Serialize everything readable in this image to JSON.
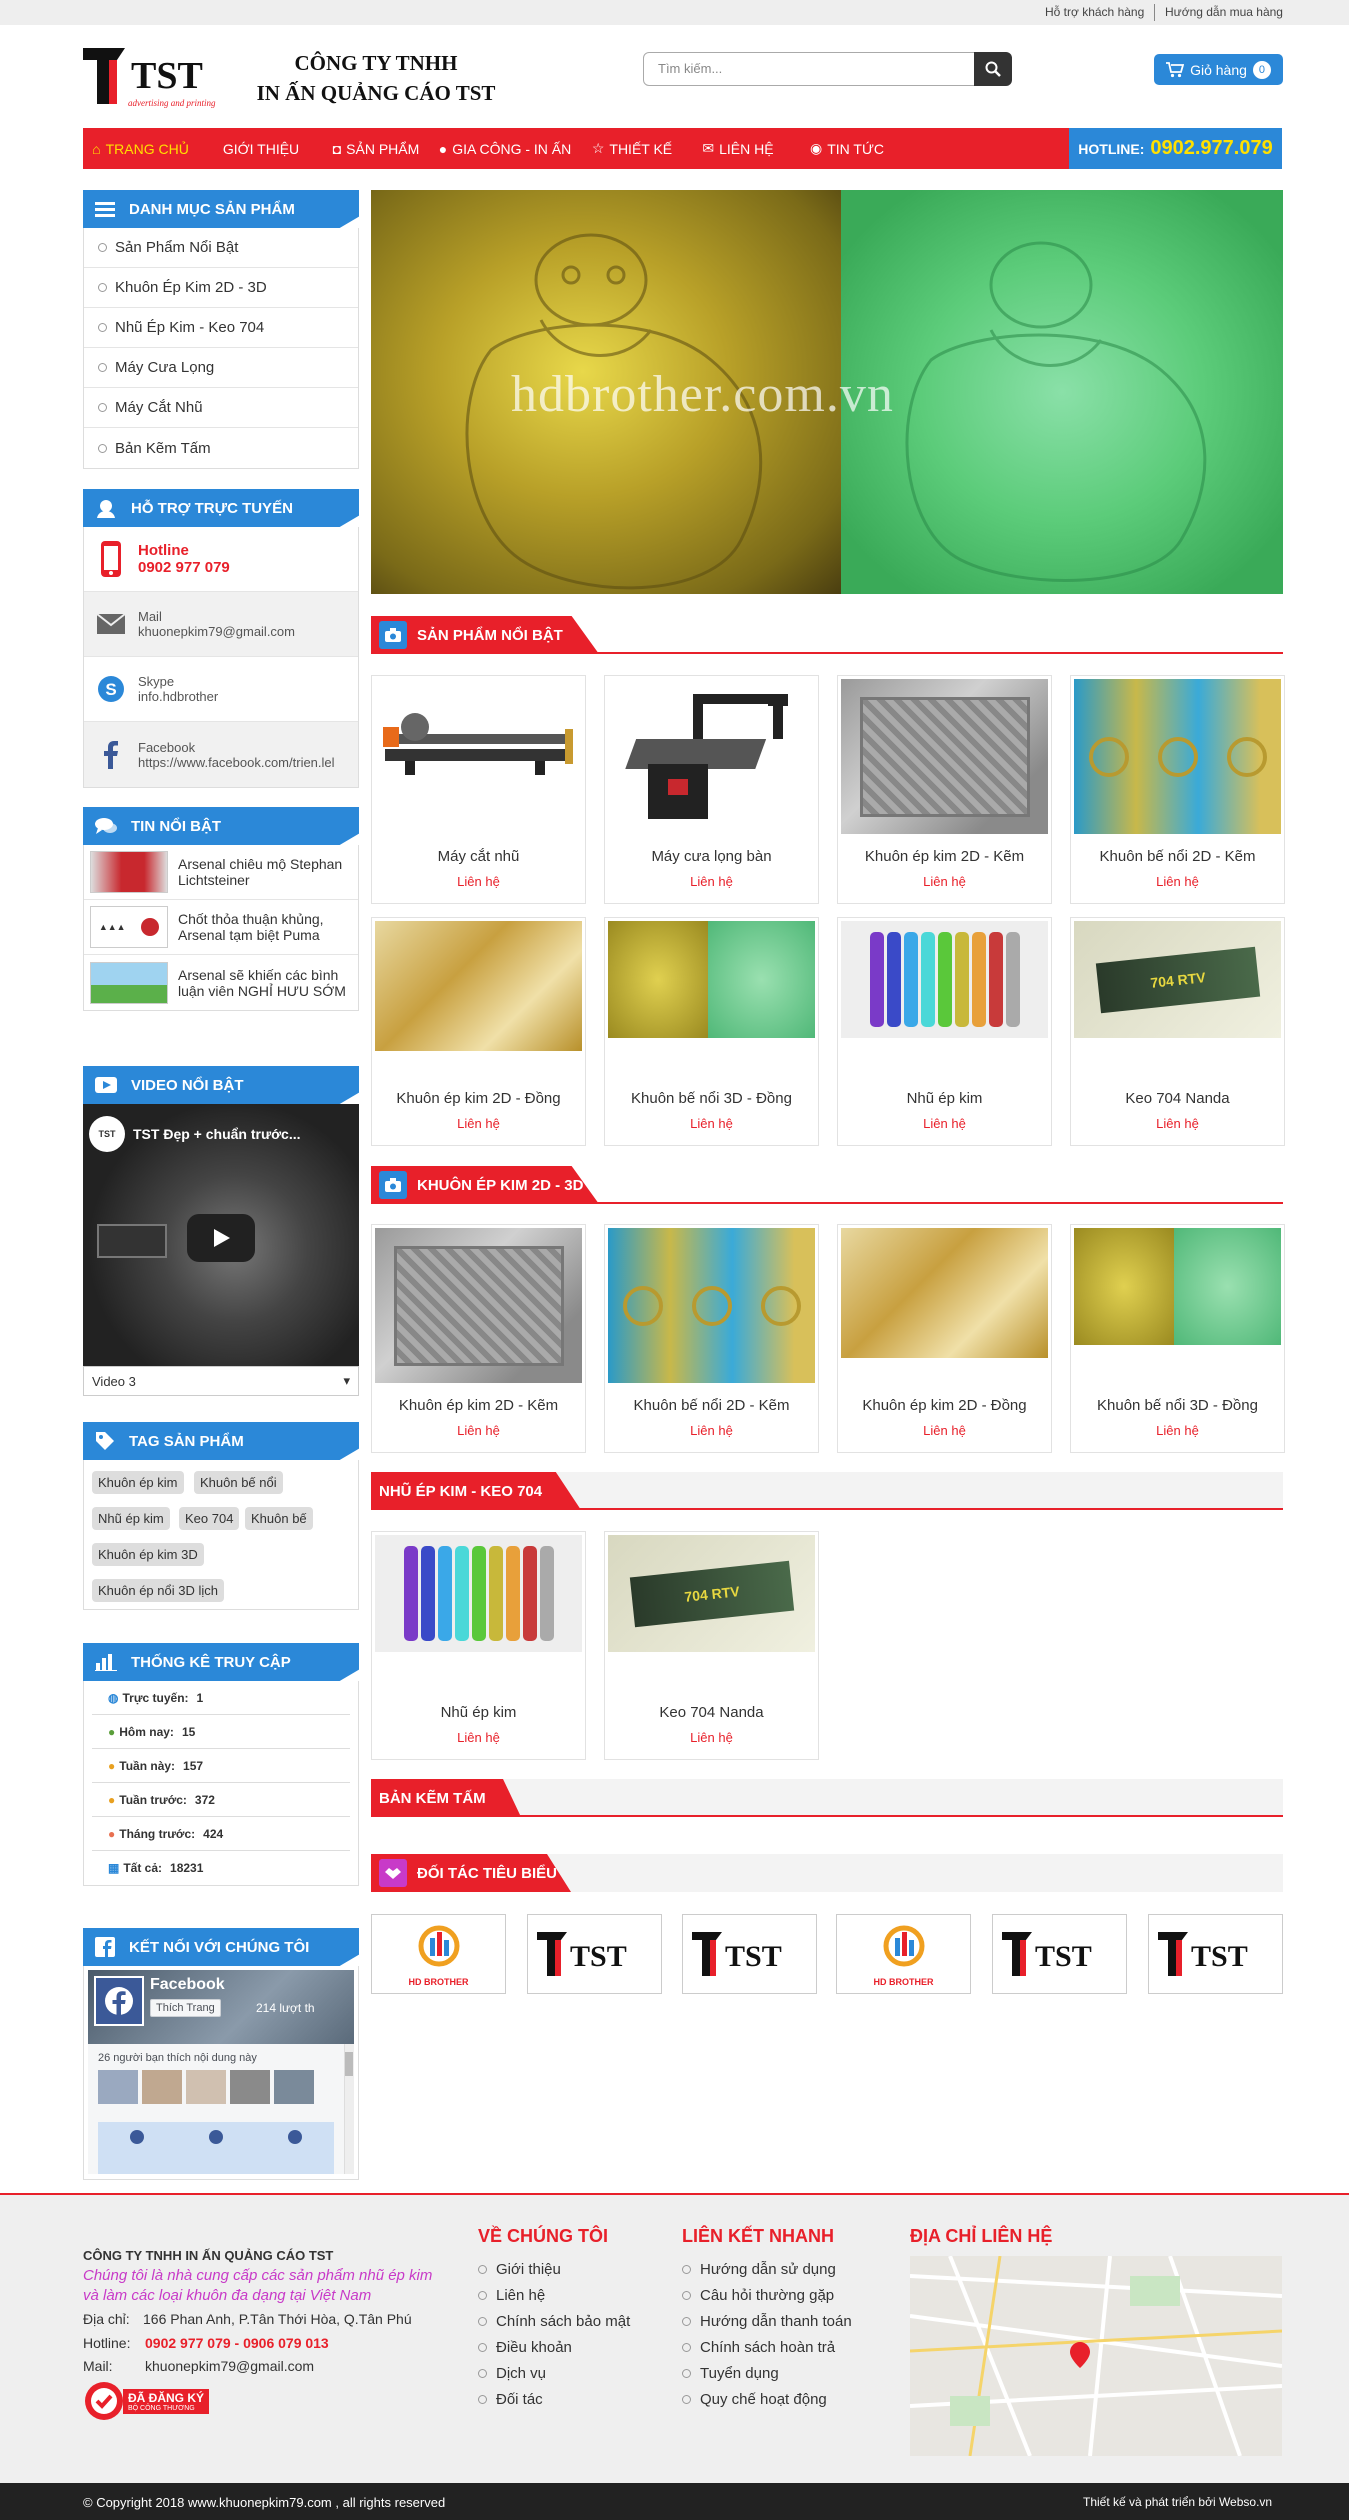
{
  "topbar": {
    "support": "Hỗ trợ khách hàng",
    "guide": "Hướng dẫn mua hàng"
  },
  "logo": {
    "text": "TST",
    "tagline": "advertising and printing"
  },
  "company": {
    "line1": "CÔNG TY TNHH",
    "line2": "IN ẤN QUẢNG CÁO TST"
  },
  "search": {
    "placeholder": "Tìm kiếm..."
  },
  "cart": {
    "label": "Giỏ hàng",
    "count": "0"
  },
  "nav": [
    "TRANG CHỦ",
    "GIỚI THIỆU",
    "SẢN PHẨM",
    "GIA CÔNG - IN ẤN",
    "THIẾT KẾ",
    "LIÊN HỆ",
    "TIN TỨC"
  ],
  "hotline": {
    "label": "HOTLINE:",
    "number": "0902.977.079"
  },
  "categories": {
    "title": "DANH MỤC SẢN PHẨM",
    "items": [
      "Sản Phẩm Nổi Bật",
      "Khuôn Ép Kim 2D - 3D",
      "Nhũ Ép Kim - Keo 704",
      "Máy Cưa Lọng",
      "Máy Cắt Nhũ",
      "Bản Kẽm Tấm"
    ]
  },
  "support": {
    "title": "HỖ TRỢ TRỰC TUYẾN",
    "hotline_label": "Hotline",
    "hotline_value": "0902 977 079",
    "mail_label": "Mail",
    "mail_value": "khuonepkim79@gmail.com",
    "skype_label": "Skype",
    "skype_value": "info.hdbrother",
    "fb_label": "Facebook",
    "fb_value": "https://www.facebook.com/trien.lel"
  },
  "news": {
    "title": "TIN NỔI BẬT",
    "items": [
      "Arsenal chiêu mộ Stephan Lichtsteiner",
      "Chốt thỏa thuận khủng, Arsenal tạm biệt Puma",
      "Arsenal sẽ khiến các bình luận viên NGHỈ HƯU SỚM"
    ]
  },
  "video": {
    "title": "VIDEO NỔI BẬT",
    "caption": "TST Đẹp + chuẩn trước...",
    "select": "Video 3"
  },
  "tags": {
    "title": "TAG SẢN PHẨM",
    "items": [
      "Khuôn ép kim",
      "Khuôn bế nổi",
      "Nhũ ép kim",
      "Keo 704",
      "Khuôn bế",
      "Khuôn ép kim 3D",
      "Khuôn ép nổi 3D lịch"
    ]
  },
  "stats": {
    "title": "THỐNG KÊ TRUY CẬP",
    "rows": [
      {
        "label": "Trực tuyến:",
        "value": "1"
      },
      {
        "label": "Hôm nay:",
        "value": "15"
      },
      {
        "label": "Tuần này:",
        "value": "157"
      },
      {
        "label": "Tuần trước:",
        "value": "372"
      },
      {
        "label": "Tháng trước:",
        "value": "424"
      },
      {
        "label": "Tất cả:",
        "value": "18231"
      }
    ]
  },
  "connect": {
    "title": "KẾT NỐI VỚI CHÚNG TÔI",
    "fb_name": "Facebook",
    "like": "Thích Trang",
    "likes": "214 lượt th",
    "friends": "26 người bạn thích nội dung này"
  },
  "banner": {
    "watermark": "hdbrother.com.vn"
  },
  "featured": {
    "title": "SẢN PHẨM NỔI BẬT",
    "items": [
      {
        "name": "Máy cắt nhũ",
        "price": "Liên hệ"
      },
      {
        "name": "Máy cưa lọng bàn",
        "price": "Liên hệ"
      },
      {
        "name": "Khuôn ép kim 2D - Kẽm",
        "price": "Liên hệ"
      },
      {
        "name": "Khuôn bế nổi 2D - Kẽm",
        "price": "Liên hệ"
      },
      {
        "name": "Khuôn ép kim 2D - Đồng",
        "price": "Liên hệ"
      },
      {
        "name": "Khuôn bế nổi 3D - Đồng",
        "price": "Liên hệ"
      },
      {
        "name": "Nhũ ép kim",
        "price": "Liên hệ"
      },
      {
        "name": "Keo 704 Nanda",
        "price": "Liên hệ"
      }
    ]
  },
  "khuon": {
    "title": "KHUÔN ÉP KIM 2D - 3D",
    "items": [
      {
        "name": "Khuôn ép kim 2D - Kẽm",
        "price": "Liên hệ"
      },
      {
        "name": "Khuôn bế nổi 2D - Kẽm",
        "price": "Liên hệ"
      },
      {
        "name": "Khuôn ép kim 2D - Đồng",
        "price": "Liên hệ"
      },
      {
        "name": "Khuôn bế nổi 3D - Đồng",
        "price": "Liên hệ"
      }
    ]
  },
  "nhu": {
    "title": "NHŨ ÉP KIM - KEO 704",
    "items": [
      {
        "name": "Nhũ ép kim",
        "price": "Liên hệ"
      },
      {
        "name": "Keo 704 Nanda",
        "price": "Liên hệ"
      }
    ]
  },
  "kem": {
    "title": "BẢN KẼM TẤM"
  },
  "partners": {
    "title": "ĐỐI TÁC TIÊU BIỂU",
    "hd": "HD BROTHER"
  },
  "footer": {
    "company": "CÔNG TY TNHH IN ẤN QUẢNG CÁO TST",
    "slogan": "Chúng tôi là nhà cung cấp các sản phẩm nhũ ép kim và làm các loại khuôn đa dạng tại Việt Nam",
    "addr_label": "Địa chỉ:",
    "addr": "166 Phan Anh, P.Tân Thới Hòa, Q.Tân Phú",
    "phone_label": "Hotline:",
    "phone": "0902 977 079 - 0906 079 013",
    "mail_label": "Mail:",
    "mail": "khuonepkim79@gmail.com",
    "badge": "ĐÃ ĐĂNG KÝ",
    "badge_sub": "BỘ CÔNG THƯƠNG",
    "about_title": "VỀ CHÚNG TÔI",
    "about": [
      "Giới thiệu",
      "Liên hệ",
      "Chính sách bảo mật",
      "Điều khoản",
      "Dịch vụ",
      "Đối tác"
    ],
    "links_title": "LIÊN KẾT NHANH",
    "links": [
      "Hướng dẫn sử dụng",
      "Câu hỏi thường gặp",
      "Hướng dẫn thanh toán",
      "Chính sách hoàn trả",
      "Tuyển dụng",
      "Quy chế hoạt động"
    ],
    "contact_title": "ĐỊA CHỈ LIÊN HỆ"
  },
  "bottom": {
    "copyright": "© Copyright 2018 www.khuonepkim79.com , all rights reserved",
    "credit": "Thiết kế và phát triển bởi Webso.vn"
  }
}
